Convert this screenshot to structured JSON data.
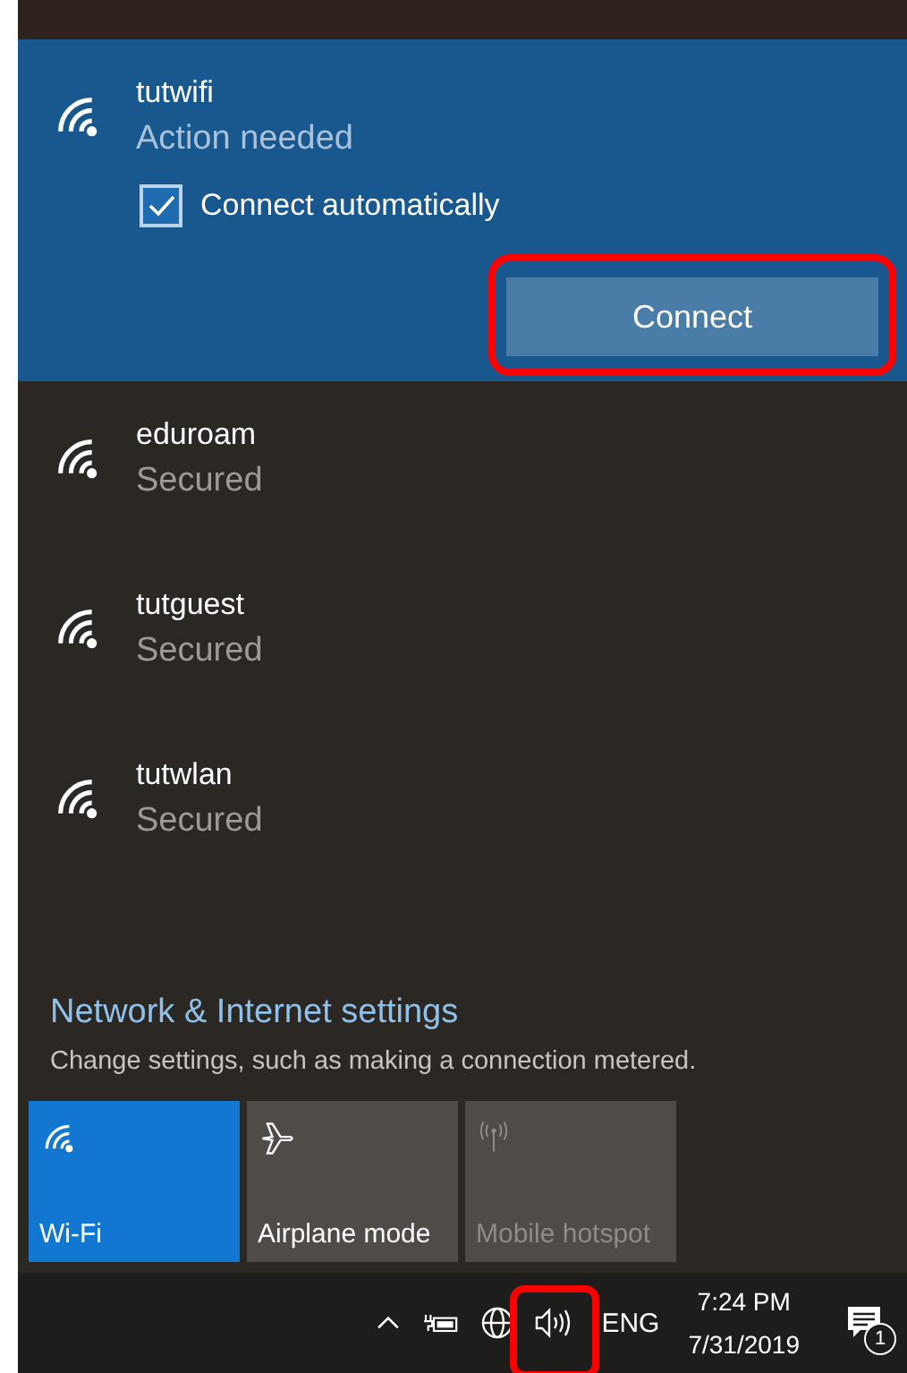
{
  "networks": [
    {
      "name": "tutwifi",
      "status": "Action needed",
      "selected": true,
      "connect_automatically": {
        "label": "Connect automatically",
        "checked": true
      },
      "connect_button": {
        "label": "Connect",
        "highlighted": true
      }
    },
    {
      "name": "eduroam",
      "status": "Secured",
      "selected": false
    },
    {
      "name": "tutguest",
      "status": "Secured",
      "selected": false
    },
    {
      "name": "tutwlan",
      "status": "Secured",
      "selected": false
    }
  ],
  "settings": {
    "link": "Network & Internet settings",
    "description": "Change settings, such as making a connection metered."
  },
  "tiles": [
    {
      "kind": "wifi",
      "label": "Wi-Fi",
      "on": true,
      "disabled": false
    },
    {
      "kind": "airplane",
      "label": "Airplane mode",
      "on": false,
      "disabled": false
    },
    {
      "kind": "hotspot",
      "label": "Mobile hotspot",
      "on": false,
      "disabled": true
    }
  ],
  "taskbar": {
    "language": "ENG",
    "time": "7:24 PM",
    "date": "7/31/2019",
    "notification_count": "1",
    "volume_highlighted": true
  }
}
